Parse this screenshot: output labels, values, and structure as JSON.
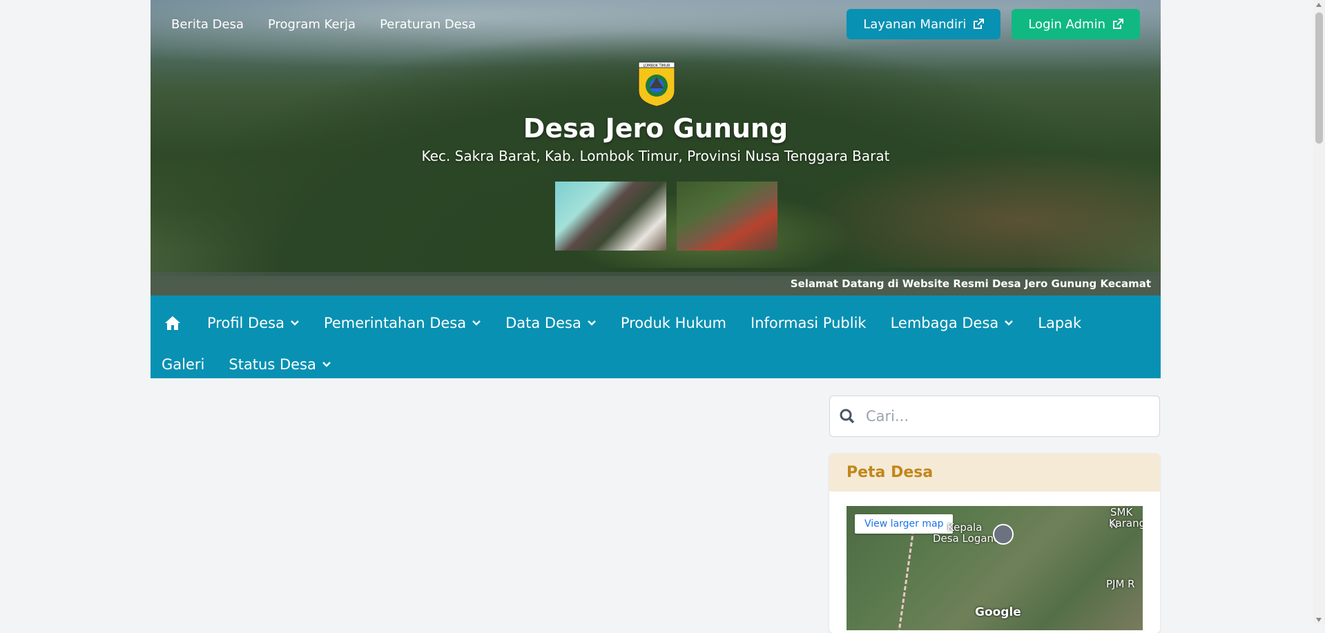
{
  "topnav": {
    "links": [
      "Berita Desa",
      "Program Kerja",
      "Peraturan Desa"
    ],
    "layanan_label": "Layanan Mandiri",
    "login_label": "Login Admin"
  },
  "hero": {
    "title": "Desa Jero Gunung",
    "subtitle": "Kec. Sakra Barat, Kab. Lombok Timur, Provinsi Nusa Tenggara Barat",
    "logo_text": "LOMBOK TIMUR",
    "ticker": "Selamat Datang di Website Resmi Desa Jero Gunung Kecamat"
  },
  "mainnav": {
    "items": [
      {
        "label": "Profil Desa",
        "dropdown": true
      },
      {
        "label": "Pemerintahan Desa",
        "dropdown": true
      },
      {
        "label": "Data Desa",
        "dropdown": true
      },
      {
        "label": "Produk Hukum",
        "dropdown": false
      },
      {
        "label": "Informasi Publik",
        "dropdown": false
      },
      {
        "label": "Lembaga Desa",
        "dropdown": true
      },
      {
        "label": "Lapak",
        "dropdown": false
      },
      {
        "label": "Galeri",
        "dropdown": false
      },
      {
        "label": "Status Desa",
        "dropdown": true
      }
    ]
  },
  "search": {
    "placeholder": "Cari..."
  },
  "peta": {
    "title": "Peta Desa",
    "view_larger": "View larger map",
    "labels": [
      "Kepala",
      "Desa Logandu",
      "SMK N",
      "Karang",
      "PJM R"
    ],
    "google": "Google"
  },
  "colors": {
    "nav": "#0891b2",
    "accent_green": "#10b981",
    "card_head": "#f5ead5",
    "card_title": "#c2861b"
  }
}
